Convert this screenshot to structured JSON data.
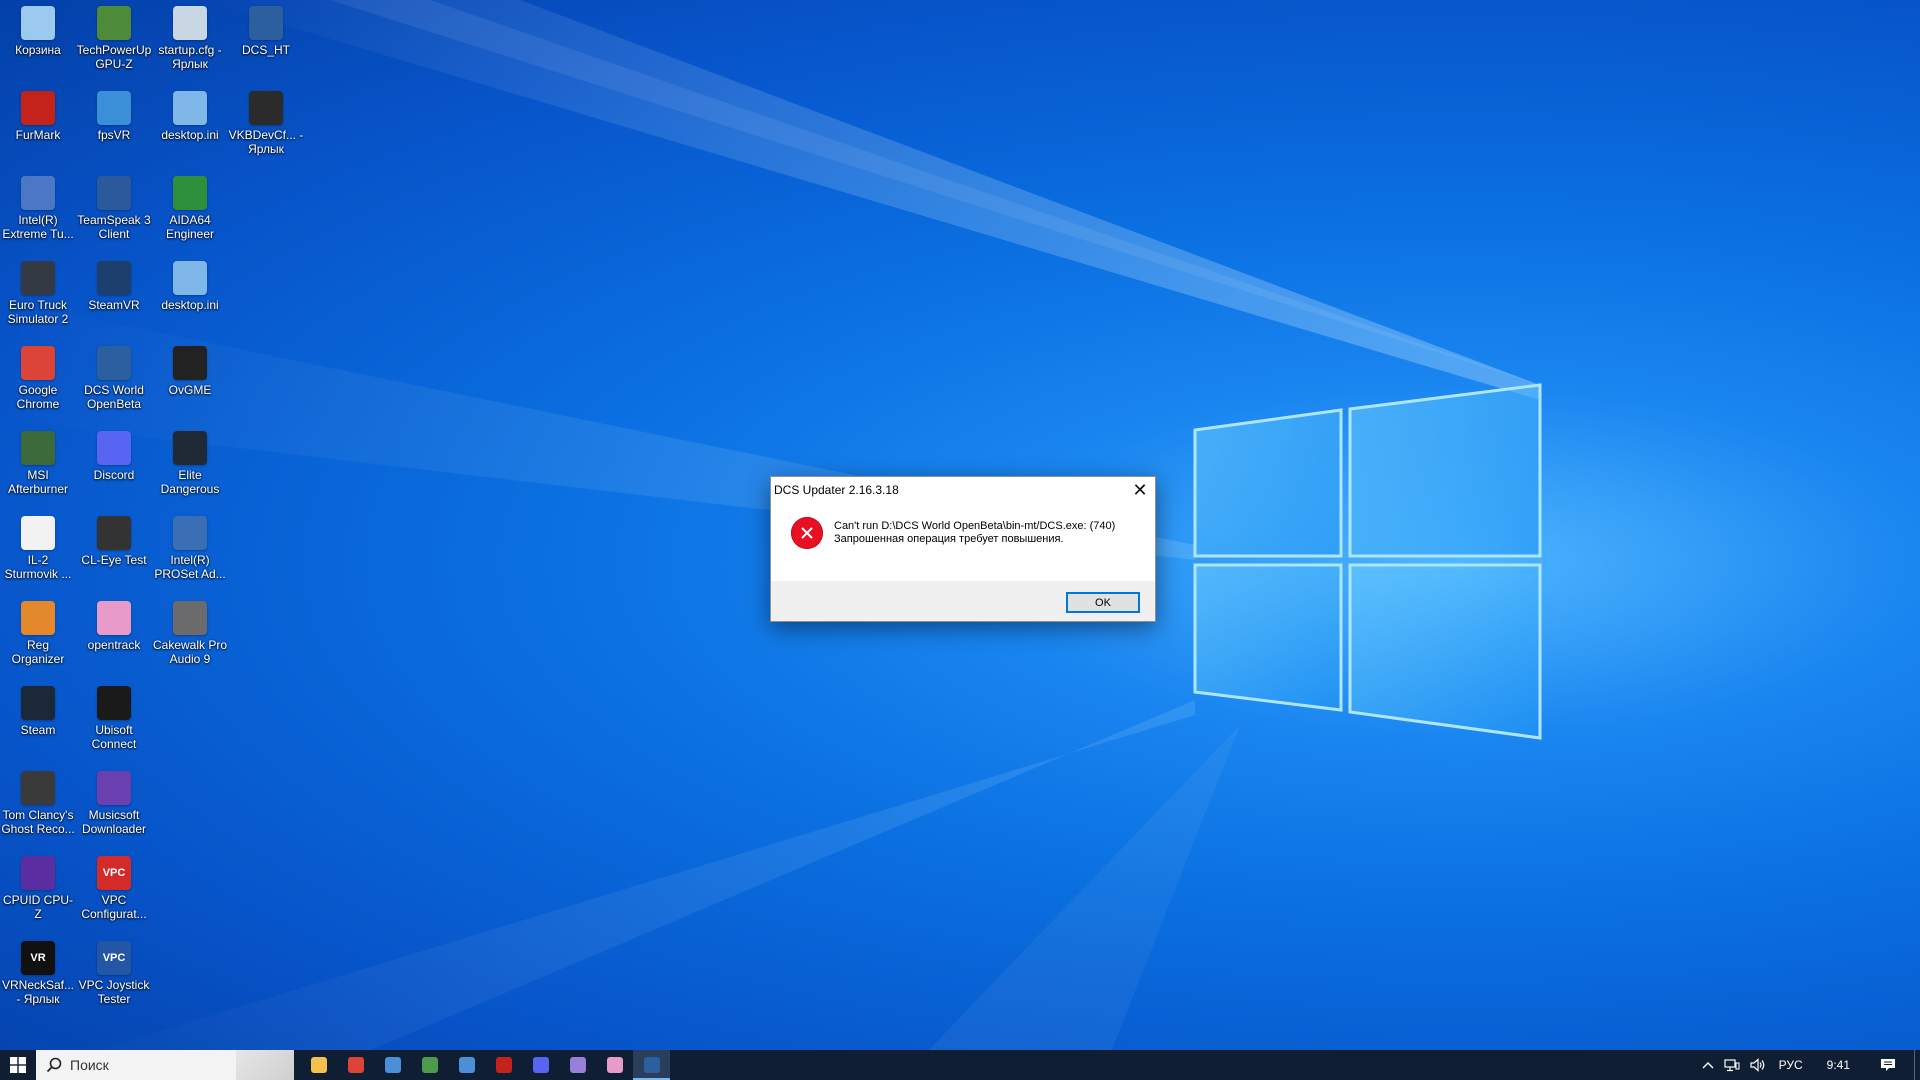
{
  "desktop": {
    "icons": [
      {
        "label": "Корзина",
        "icon": "recycle-bin-icon",
        "color": "#9bc9ef"
      },
      {
        "label": "TechPowerUp GPU-Z",
        "icon": "gpu-z-icon",
        "color": "#4d8a3a"
      },
      {
        "label": "startup.cfg - Ярлык",
        "icon": "cfg-file-icon",
        "color": "#c9d6e3"
      },
      {
        "label": "DCS_HT",
        "icon": "dcs-icon",
        "color": "#2c5f9e"
      },
      {
        "label": "FurMark",
        "icon": "furmark-icon",
        "color": "#c3231a"
      },
      {
        "label": "fpsVR",
        "icon": "fpsvr-icon",
        "color": "#3a8fd8"
      },
      {
        "label": "desktop.ini",
        "icon": "ini-file-icon",
        "color": "#7fb7e8"
      },
      {
        "label": "VKBDevCf... - Ярлык",
        "icon": "joystick-icon",
        "color": "#2b2b2b"
      },
      {
        "label": "Intel(R) Extreme Tu...",
        "icon": "intel-xtu-icon",
        "color": "#4a78c4"
      },
      {
        "label": "TeamSpeak 3 Client",
        "icon": "teamspeak-icon",
        "color": "#2a5a9a"
      },
      {
        "label": "AIDA64 Engineer",
        "icon": "aida64-icon",
        "color": "#2e8f3a"
      },
      {
        "label": "Euro Truck Simulator 2",
        "icon": "ets2-icon",
        "color": "#333a44"
      },
      {
        "label": "SteamVR",
        "icon": "steamvr-icon",
        "color": "#1c3f6e"
      },
      {
        "label": "desktop.ini",
        "icon": "ini-file-icon",
        "color": "#7fb7e8"
      },
      {
        "label": "Google Chrome",
        "icon": "chrome-icon",
        "color": "#db4437"
      },
      {
        "label": "DCS World OpenBeta",
        "icon": "dcs-icon",
        "color": "#2c5f9e"
      },
      {
        "label": "OvGME",
        "icon": "ovgme-icon",
        "color": "#222222"
      },
      {
        "label": "MSI Afterburner",
        "icon": "afterburner-icon",
        "color": "#3b6b3a"
      },
      {
        "label": "Discord",
        "icon": "discord-icon",
        "color": "#5865f2"
      },
      {
        "label": "Elite Dangerous",
        "icon": "elite-icon",
        "color": "#1f2a36"
      },
      {
        "label": "IL-2 Sturmovik ...",
        "icon": "file-icon",
        "color": "#f2f2f2"
      },
      {
        "label": "CL-Eye Test",
        "icon": "camera-icon",
        "color": "#333333"
      },
      {
        "label": "Intel(R) PROSet Ad...",
        "icon": "network-adapter-icon",
        "color": "#3a6fb5"
      },
      {
        "label": "Reg Organizer",
        "icon": "reg-organizer-icon",
        "color": "#e3892c"
      },
      {
        "label": "opentrack",
        "icon": "opentrack-icon",
        "color": "#e89ac8"
      },
      {
        "label": "Cakewalk Pro Audio 9",
        "icon": "cakewalk-icon",
        "color": "#6b6b6b"
      },
      {
        "label": "Steam",
        "icon": "steam-icon",
        "color": "#1b2838"
      },
      {
        "label": "Ubisoft Connect",
        "icon": "ubisoft-icon",
        "color": "#1a1a1a"
      },
      {
        "label": "Tom Clancy's Ghost Reco...",
        "icon": "ghost-recon-icon",
        "color": "#3a3a3a"
      },
      {
        "label": "Musicsoft Downloader",
        "icon": "musicsoft-icon",
        "color": "#6a3fb0"
      },
      {
        "label": "CPUID CPU-Z",
        "icon": "cpu-z-icon",
        "color": "#5a2ea0"
      },
      {
        "label": "VPC Configurat...",
        "icon": "vpc-icon",
        "color": "#d32a2a",
        "text": "VPC"
      },
      {
        "label": "VRNeckSaf... - Ярлык",
        "icon": "vrnecksafer-icon",
        "color": "#111111",
        "text": "VR"
      },
      {
        "label": "VPC Joystick Tester",
        "icon": "vpc-tester-icon",
        "color": "#2456a6",
        "text": "VPC"
      }
    ]
  },
  "dialog": {
    "title": "DCS Updater 2.16.3.18",
    "close_glyph": "✕",
    "message_line1": "Can't run D:\\DCS World OpenBeta\\bin-mt/DCS.exe: (740)",
    "message_line2": "Запрошенная операция требует повышения.",
    "ok_label": "OK",
    "error_icon": "error-icon",
    "error_color": "#e81123"
  },
  "taskbar": {
    "search_placeholder": "Поиск",
    "apps": [
      {
        "name": "file-explorer",
        "color": "#f2c14e"
      },
      {
        "name": "chrome",
        "color": "#db4437"
      },
      {
        "name": "app-window",
        "color": "#4a90d9"
      },
      {
        "name": "app-green",
        "color": "#4c9a4c"
      },
      {
        "name": "steamvr",
        "color": "#4a8fd8"
      },
      {
        "name": "furmark",
        "color": "#c3231a"
      },
      {
        "name": "discord",
        "color": "#5865f2"
      },
      {
        "name": "app-purple",
        "color": "#9a7fd8"
      },
      {
        "name": "opentrack",
        "color": "#e89ac8"
      },
      {
        "name": "dcs",
        "color": "#2c5f9e"
      }
    ],
    "tray": {
      "language": "РУС",
      "time": "9:41"
    }
  },
  "colors": {
    "accent": "#0078d7",
    "taskbar_bg": "#0f1e33"
  }
}
